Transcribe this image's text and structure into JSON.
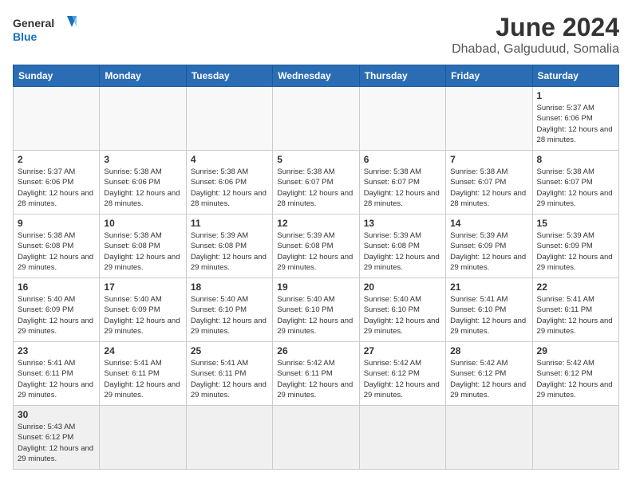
{
  "logo": {
    "general": "General",
    "blue": "Blue"
  },
  "title": "June 2024",
  "subtitle": "Dhabad, Galguduud, Somalia",
  "days_of_week": [
    "Sunday",
    "Monday",
    "Tuesday",
    "Wednesday",
    "Thursday",
    "Friday",
    "Saturday"
  ],
  "weeks": [
    [
      {
        "day": "",
        "empty": true
      },
      {
        "day": "",
        "empty": true
      },
      {
        "day": "",
        "empty": true
      },
      {
        "day": "",
        "empty": true
      },
      {
        "day": "",
        "empty": true
      },
      {
        "day": "",
        "empty": true
      },
      {
        "day": "1",
        "sunrise": "5:37 AM",
        "sunset": "6:06 PM",
        "daylight": "12 hours and 28 minutes."
      }
    ],
    [
      {
        "day": "2",
        "sunrise": "5:37 AM",
        "sunset": "6:06 PM",
        "daylight": "12 hours and 28 minutes."
      },
      {
        "day": "3",
        "sunrise": "5:38 AM",
        "sunset": "6:06 PM",
        "daylight": "12 hours and 28 minutes."
      },
      {
        "day": "4",
        "sunrise": "5:38 AM",
        "sunset": "6:06 PM",
        "daylight": "12 hours and 28 minutes."
      },
      {
        "day": "5",
        "sunrise": "5:38 AM",
        "sunset": "6:07 PM",
        "daylight": "12 hours and 28 minutes."
      },
      {
        "day": "6",
        "sunrise": "5:38 AM",
        "sunset": "6:07 PM",
        "daylight": "12 hours and 28 minutes."
      },
      {
        "day": "7",
        "sunrise": "5:38 AM",
        "sunset": "6:07 PM",
        "daylight": "12 hours and 28 minutes."
      },
      {
        "day": "8",
        "sunrise": "5:38 AM",
        "sunset": "6:07 PM",
        "daylight": "12 hours and 29 minutes."
      }
    ],
    [
      {
        "day": "9",
        "sunrise": "5:38 AM",
        "sunset": "6:08 PM",
        "daylight": "12 hours and 29 minutes."
      },
      {
        "day": "10",
        "sunrise": "5:38 AM",
        "sunset": "6:08 PM",
        "daylight": "12 hours and 29 minutes."
      },
      {
        "day": "11",
        "sunrise": "5:39 AM",
        "sunset": "6:08 PM",
        "daylight": "12 hours and 29 minutes."
      },
      {
        "day": "12",
        "sunrise": "5:39 AM",
        "sunset": "6:08 PM",
        "daylight": "12 hours and 29 minutes."
      },
      {
        "day": "13",
        "sunrise": "5:39 AM",
        "sunset": "6:08 PM",
        "daylight": "12 hours and 29 minutes."
      },
      {
        "day": "14",
        "sunrise": "5:39 AM",
        "sunset": "6:09 PM",
        "daylight": "12 hours and 29 minutes."
      },
      {
        "day": "15",
        "sunrise": "5:39 AM",
        "sunset": "6:09 PM",
        "daylight": "12 hours and 29 minutes."
      }
    ],
    [
      {
        "day": "16",
        "sunrise": "5:40 AM",
        "sunset": "6:09 PM",
        "daylight": "12 hours and 29 minutes."
      },
      {
        "day": "17",
        "sunrise": "5:40 AM",
        "sunset": "6:09 PM",
        "daylight": "12 hours and 29 minutes."
      },
      {
        "day": "18",
        "sunrise": "5:40 AM",
        "sunset": "6:10 PM",
        "daylight": "12 hours and 29 minutes."
      },
      {
        "day": "19",
        "sunrise": "5:40 AM",
        "sunset": "6:10 PM",
        "daylight": "12 hours and 29 minutes."
      },
      {
        "day": "20",
        "sunrise": "5:40 AM",
        "sunset": "6:10 PM",
        "daylight": "12 hours and 29 minutes."
      },
      {
        "day": "21",
        "sunrise": "5:41 AM",
        "sunset": "6:10 PM",
        "daylight": "12 hours and 29 minutes."
      },
      {
        "day": "22",
        "sunrise": "5:41 AM",
        "sunset": "6:11 PM",
        "daylight": "12 hours and 29 minutes."
      }
    ],
    [
      {
        "day": "23",
        "sunrise": "5:41 AM",
        "sunset": "6:11 PM",
        "daylight": "12 hours and 29 minutes."
      },
      {
        "day": "24",
        "sunrise": "5:41 AM",
        "sunset": "6:11 PM",
        "daylight": "12 hours and 29 minutes."
      },
      {
        "day": "25",
        "sunrise": "5:41 AM",
        "sunset": "6:11 PM",
        "daylight": "12 hours and 29 minutes."
      },
      {
        "day": "26",
        "sunrise": "5:42 AM",
        "sunset": "6:11 PM",
        "daylight": "12 hours and 29 minutes."
      },
      {
        "day": "27",
        "sunrise": "5:42 AM",
        "sunset": "6:12 PM",
        "daylight": "12 hours and 29 minutes."
      },
      {
        "day": "28",
        "sunrise": "5:42 AM",
        "sunset": "6:12 PM",
        "daylight": "12 hours and 29 minutes."
      },
      {
        "day": "29",
        "sunrise": "5:42 AM",
        "sunset": "6:12 PM",
        "daylight": "12 hours and 29 minutes."
      }
    ],
    [
      {
        "day": "30",
        "sunrise": "5:43 AM",
        "sunset": "6:12 PM",
        "daylight": "12 hours and 29 minutes.",
        "last": true
      },
      {
        "day": "",
        "empty": true,
        "last": true
      },
      {
        "day": "",
        "empty": true,
        "last": true
      },
      {
        "day": "",
        "empty": true,
        "last": true
      },
      {
        "day": "",
        "empty": true,
        "last": true
      },
      {
        "day": "",
        "empty": true,
        "last": true
      },
      {
        "day": "",
        "empty": true,
        "last": true
      }
    ]
  ]
}
